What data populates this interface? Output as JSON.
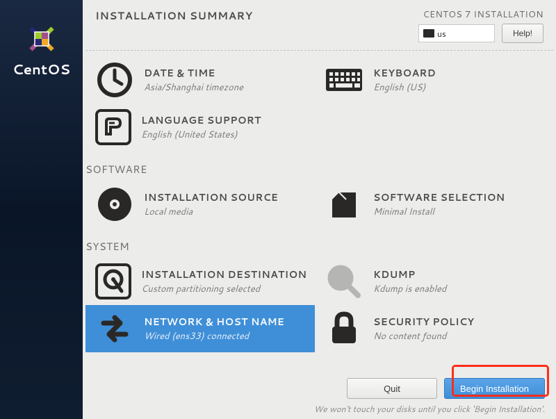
{
  "brand": "CentOS",
  "header": {
    "title": "INSTALLATION SUMMARY",
    "distro": "CENTOS 7 INSTALLATION",
    "keyboard_layout": "us",
    "help_label": "Help!"
  },
  "sections": {
    "localization": {
      "datetime": {
        "title": "DATE & TIME",
        "sub": "Asia/Shanghai timezone"
      },
      "keyboard": {
        "title": "KEYBOARD",
        "sub": "English (US)"
      },
      "language": {
        "title": "LANGUAGE SUPPORT",
        "sub": "English (United States)"
      }
    },
    "software_title": "SOFTWARE",
    "software": {
      "source": {
        "title": "INSTALLATION SOURCE",
        "sub": "Local media"
      },
      "selection": {
        "title": "SOFTWARE SELECTION",
        "sub": "Minimal Install"
      }
    },
    "system_title": "SYSTEM",
    "system": {
      "destination": {
        "title": "INSTALLATION DESTINATION",
        "sub": "Custom partitioning selected"
      },
      "kdump": {
        "title": "KDUMP",
        "sub": "Kdump is enabled"
      },
      "network": {
        "title": "NETWORK & HOST NAME",
        "sub": "Wired (ens33) connected"
      },
      "security": {
        "title": "SECURITY POLICY",
        "sub": "No content found"
      }
    }
  },
  "footer": {
    "quit_label": "Quit",
    "begin_label": "Begin Installation",
    "note": "We won't touch your disks until you click 'Begin Installation'."
  }
}
